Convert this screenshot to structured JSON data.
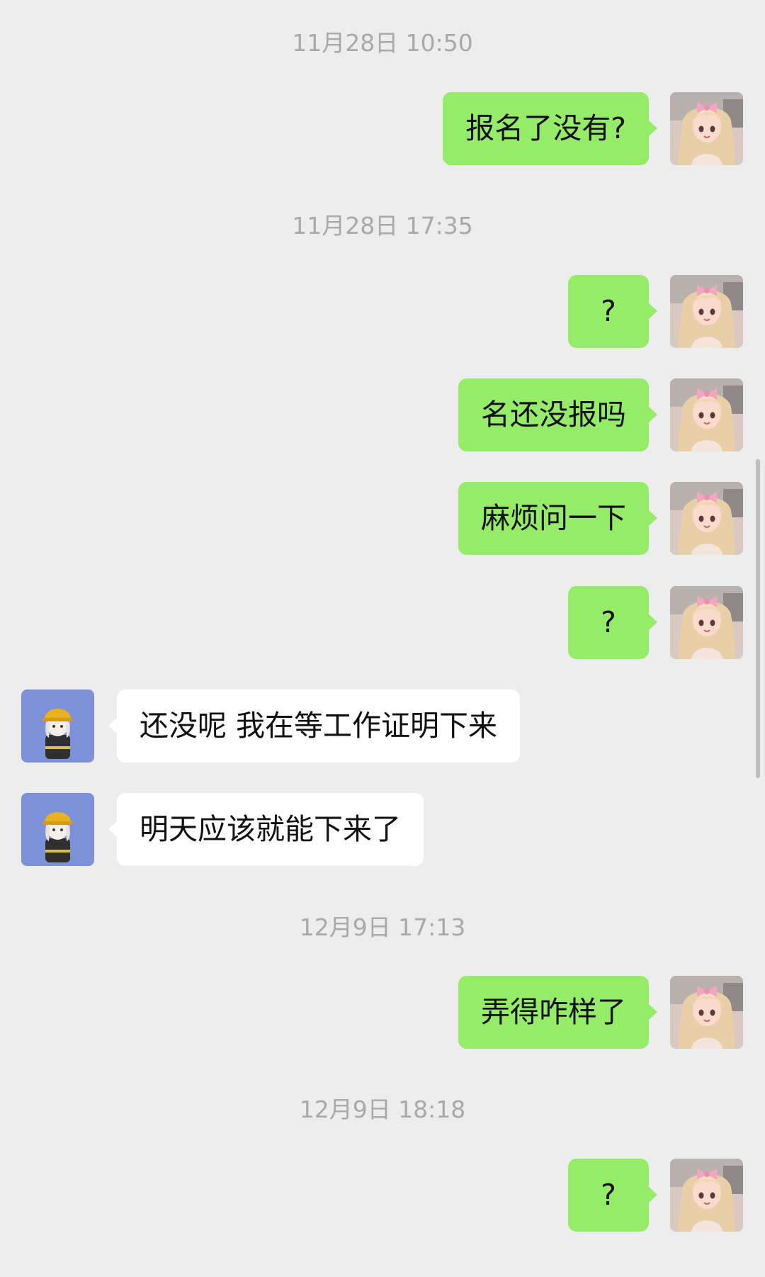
{
  "chat": {
    "timestamps": [
      "11月28日 10:50",
      "11月28日 17:35",
      "12月9日 17:13",
      "12月9日 18:18"
    ],
    "messages": [
      {
        "sender": "me",
        "text": "报名了没有?"
      },
      {
        "sender": "me",
        "text": "?"
      },
      {
        "sender": "me",
        "text": "名还没报吗"
      },
      {
        "sender": "me",
        "text": "麻烦问一下"
      },
      {
        "sender": "me",
        "text": "?"
      },
      {
        "sender": "them",
        "text": "还没呢 我在等工作证明下来"
      },
      {
        "sender": "them",
        "text": "明天应该就能下来了"
      },
      {
        "sender": "me",
        "text": "弄得咋样了"
      },
      {
        "sender": "me",
        "text": "?"
      }
    ],
    "avatars": {
      "me": "girl-avatar-icon",
      "them": "construction-worker-avatar-icon"
    }
  },
  "colors": {
    "background": "#ededed",
    "my_bubble": "#95ec69",
    "their_bubble": "#ffffff",
    "timestamp_text": "#a9a9a9",
    "their_avatar_bg": "#7d90d8"
  }
}
